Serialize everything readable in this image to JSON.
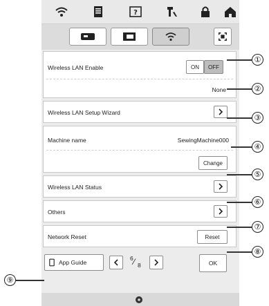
{
  "toolbar": {
    "icons": [
      "wifi-icon",
      "document-icon",
      "help-icon",
      "machine-settings-icon",
      "lock-icon",
      "home-icon"
    ]
  },
  "tabs": {
    "items": [
      "sewing-machine-icon",
      "embroidery-icon",
      "wifi-icon"
    ],
    "active": 2
  },
  "settings": {
    "wireless_lan_enable": {
      "label": "Wireless LAN Enable",
      "on_label": "ON",
      "off_label": "OFF",
      "state": "OFF",
      "network_value": "None"
    },
    "setup_wizard": {
      "label": "Wireless LAN Setup Wizard"
    },
    "machine_name": {
      "label": "Machine name",
      "value": "SewingMachine000",
      "change_label": "Change"
    },
    "lan_status": {
      "label": "Wireless LAN Status"
    },
    "others": {
      "label": "Others"
    },
    "network_reset": {
      "label": "Network Reset",
      "reset_label": "Reset"
    }
  },
  "footer": {
    "app_guide_label": "App Guide",
    "page_current": "6",
    "page_total": "8",
    "ok_label": "OK"
  },
  "callouts": [
    "①",
    "②",
    "③",
    "④",
    "⑤",
    "⑥",
    "⑦",
    "⑧",
    "⑨"
  ]
}
